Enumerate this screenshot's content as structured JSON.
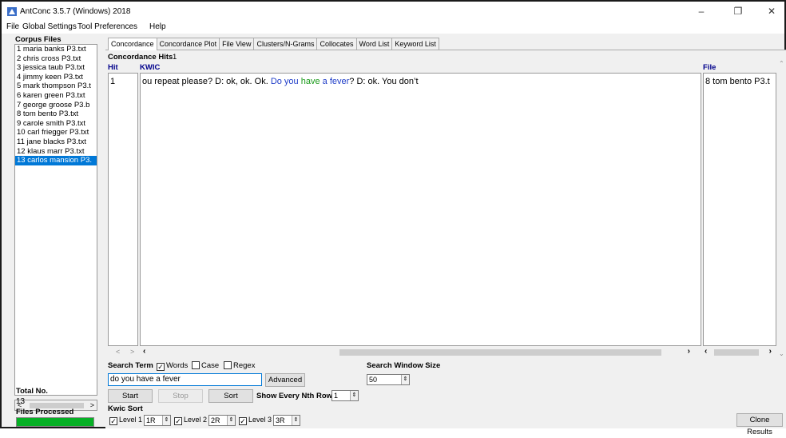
{
  "window": {
    "title": "AntConc 3.5.7 (Windows) 2018",
    "controls": {
      "minimize": "–",
      "restore": "❐",
      "close": "✕"
    }
  },
  "menu": [
    "File",
    "Global Settings",
    "Tool Preferences",
    "Help"
  ],
  "left_panel": {
    "corpus_files_label": "Corpus Files",
    "files": [
      "1 maria banks P3.txt",
      "2 chris cross P3.txt",
      "3 jessica taub P3.txt",
      "4 jimmy keen P3.txt",
      "5 mark thompson P3.t",
      "6 karen green P3.txt",
      "7 george groose P3.b",
      "8 tom bento P3.txt",
      "9 carole smith P3.txt",
      "10 carl friegger P3.txt",
      "11 jane blacks P3.txt",
      "12 klaus marr P3.txt",
      "13 carlos mansion P3."
    ],
    "selected_index": 12,
    "total_no_label": "Total No.",
    "total_no_value": "13",
    "files_processed_label": "Files Processed",
    "files_processed_progress": 1.0
  },
  "tabs": [
    "Concordance",
    "Concordance Plot",
    "File View",
    "Clusters/N-Grams",
    "Collocates",
    "Word List",
    "Keyword List"
  ],
  "active_tab": "Concordance",
  "concordance": {
    "hits_label": "Concordance Hits",
    "hits_count": "1",
    "col_hit": "Hit",
    "col_kwic": "KWIC",
    "col_file": "File",
    "rows": [
      {
        "hit": "1",
        "left_context": "ou repeat please? D: ok, ok. Ok. ",
        "kw_1": "Do you",
        "kw_2": " have",
        "kw_3": " a fever",
        "right_context": "? D: ok. You don’t",
        "file": "8 tom bento P3.t"
      }
    ]
  },
  "search": {
    "search_term_label": "Search Term",
    "words_label": "Words",
    "words_checked": true,
    "case_label": "Case",
    "case_checked": false,
    "regex_label": "Regex",
    "regex_checked": false,
    "query": "do you have a fever",
    "advanced_button": "Advanced",
    "window_size_label": "Search Window Size",
    "window_size_value": "50",
    "start_button": "Start",
    "stop_button": "Stop",
    "sort_button": "Sort",
    "nth_row_label": "Show Every Nth Row",
    "nth_row_value": "1",
    "kwic_sort_label": "Kwic Sort",
    "level1_label": "Level 1",
    "level1_value": "1R",
    "level2_label": "Level 2",
    "level2_value": "2R",
    "level3_label": "Level 3",
    "level3_value": "3R",
    "clone_button": "Clone Results"
  },
  "colors": {
    "selection": "#0078d7",
    "progress": "#06b025",
    "kw_blue": "#1e3cc8",
    "kw_green": "#1a9a1a"
  }
}
